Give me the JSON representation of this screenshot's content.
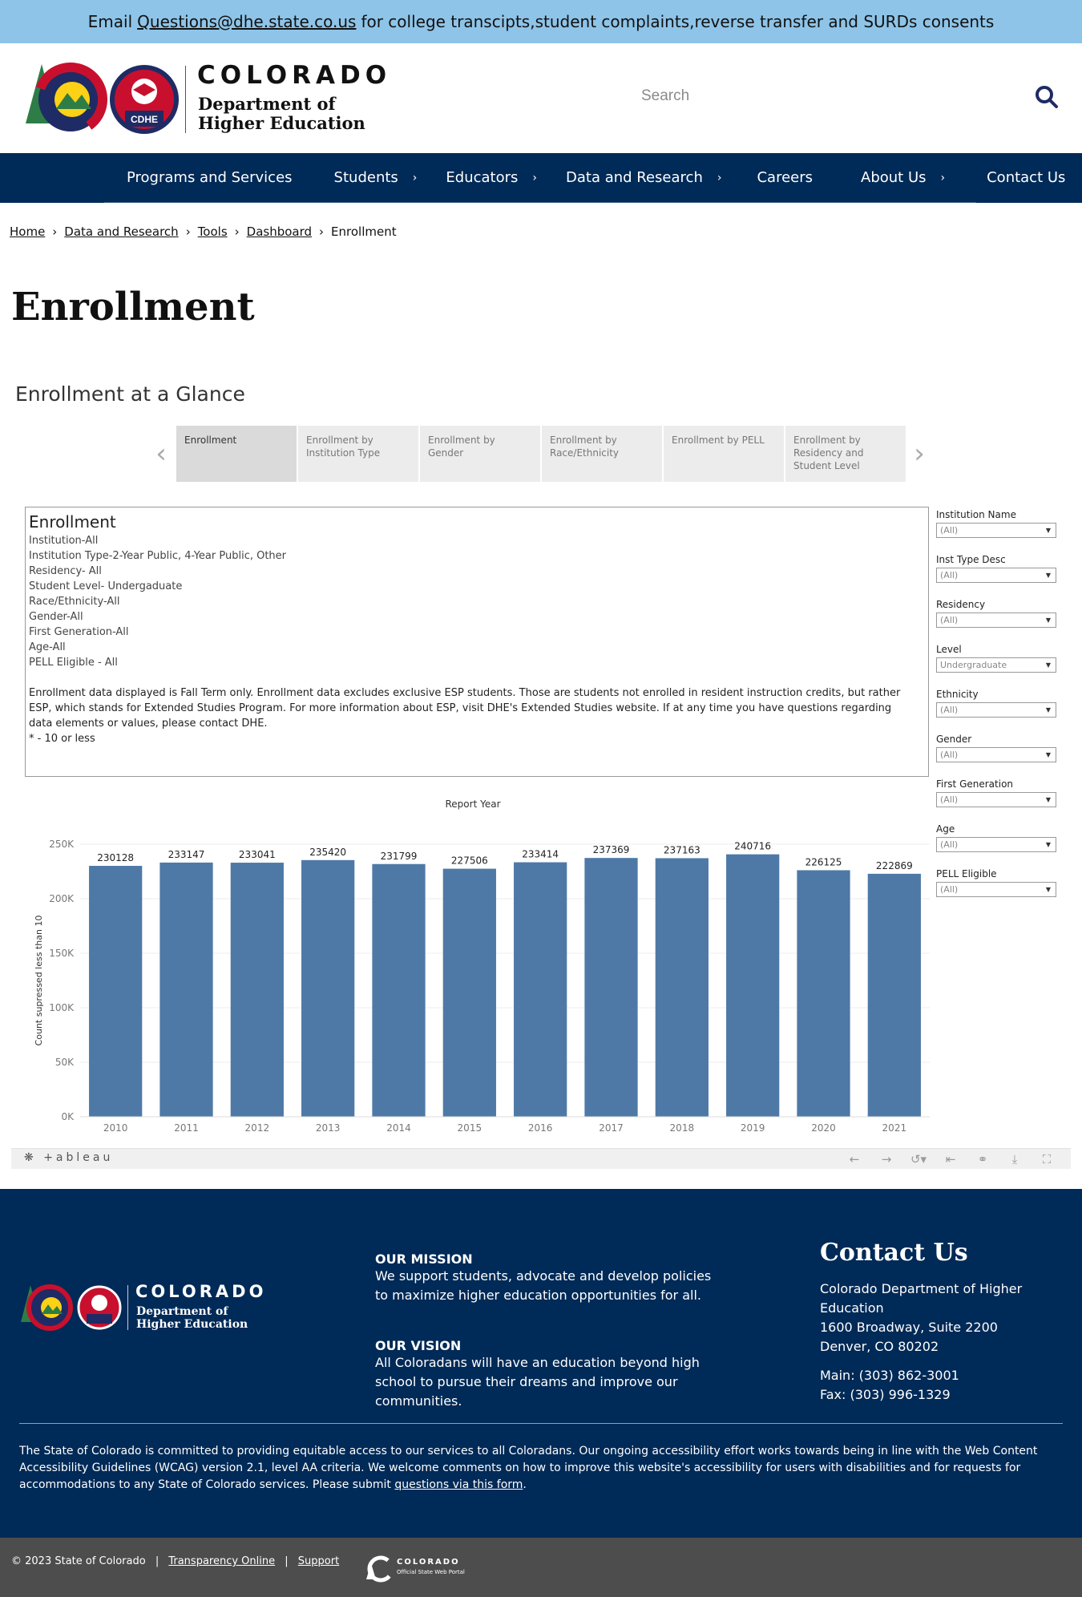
{
  "banner": {
    "prefix": "Email",
    "email": "Questions@dhe.state.co.us",
    "suffix": "for college transcipts,student complaints,reverse transfer and SURDs consents"
  },
  "header": {
    "brand": "COLORADO",
    "dept_line1": "Department of",
    "dept_line2": "Higher Education",
    "logo_badge": "CDHE",
    "search_placeholder": "Search"
  },
  "nav": [
    {
      "label": "Programs and Services",
      "has_chevron": false
    },
    {
      "label": "Students",
      "has_chevron": true
    },
    {
      "label": "Educators",
      "has_chevron": true
    },
    {
      "label": "Data and Research",
      "has_chevron": true
    },
    {
      "label": "Careers",
      "has_chevron": false
    },
    {
      "label": "About Us",
      "has_chevron": true
    },
    {
      "label": "Contact Us",
      "has_chevron": false
    }
  ],
  "breadcrumb": [
    "Home",
    "Data and Research",
    "Tools",
    "Dashboard",
    "Enrollment"
  ],
  "page_title": "Enrollment",
  "section_title": "Enrollment at a Glance",
  "tabs": [
    "Enrollment",
    "Enrollment by Institution Type",
    "Enrollment by Gender",
    "Enrollment by Race/Ethnicity",
    "Enrollment by PELL",
    "Enrollment by Residency and Student Level"
  ],
  "info": {
    "heading": "Enrollment",
    "lines": [
      "Institution-All",
      "Institution Type-2-Year Public, 4-Year Public, Other",
      "Residency- All",
      "Student Level- Undergaduate",
      "Race/Ethnicity-All",
      "Gender-All",
      "First Generation-All",
      "Age-All",
      "PELL Eligible - All"
    ],
    "note": "Enrollment data displayed is Fall Term only. Enrollment data excludes exclusive ESP students. Those are students not enrolled in resident instruction credits, but rather ESP, which stands for Extended Studies Program. For more information about ESP, visit DHE's Extended Studies website. If at any time you have questions regarding data elements or values, please contact DHE.",
    "footnote": "* - 10 or less"
  },
  "filters": [
    {
      "label": "Institution Name",
      "value": "(All)"
    },
    {
      "label": "Inst Type Desc",
      "value": "(All)"
    },
    {
      "label": "Residency",
      "value": "(All)"
    },
    {
      "label": "Level",
      "value": "Undergraduate"
    },
    {
      "label": "Ethnicity",
      "value": "(All)"
    },
    {
      "label": "Gender",
      "value": "(All)"
    },
    {
      "label": "First Generation",
      "value": "(All)"
    },
    {
      "label": "Age",
      "value": "(All)"
    },
    {
      "label": "PELL Eligible",
      "value": "(All)"
    }
  ],
  "chart_data": {
    "type": "bar",
    "title": "Report Year",
    "xlabel": "",
    "ylabel": "Count supressed less than 10",
    "categories": [
      "2010",
      "2011",
      "2012",
      "2013",
      "2014",
      "2015",
      "2016",
      "2017",
      "2018",
      "2019",
      "2020",
      "2021"
    ],
    "values": [
      230128,
      233147,
      233041,
      235420,
      231799,
      227506,
      233414,
      237369,
      237163,
      240716,
      226125,
      222869
    ],
    "ylim": [
      0,
      250000
    ],
    "yticks": [
      0,
      50000,
      100000,
      150000,
      200000,
      250000
    ],
    "ytick_labels": [
      "0K",
      "50K",
      "100K",
      "150K",
      "200K",
      "250K"
    ],
    "bar_color": "#4e79a7",
    "grid": true
  },
  "tableau": {
    "logo": "+ableau"
  },
  "footer": {
    "brand": "COLORADO",
    "dept_line1": "Department of",
    "dept_line2": "Higher Education",
    "mission_title": "OUR MISSION",
    "mission_text": "We support students, advocate and develop policies to maximize higher education opportunities for all.",
    "vision_title": "OUR VISION",
    "vision_text": "All Coloradans will have an education beyond high school to pursue their dreams and improve our communities.",
    "contact_title": "Contact Us",
    "contact_org": "Colorado Department of Higher Education",
    "contact_addr1": "1600 Broadway, Suite 2200",
    "contact_addr2": "Denver, CO 80202",
    "contact_main": "Main: (303) 862-3001",
    "contact_fax": "Fax: (303) 996-1329",
    "access_text": "The State of Colorado is committed to providing equitable access to our services to all Coloradans. Our ongoing accessibility effort works towards being in line with the Web Content Accessibility Guidelines (WCAG) version 2.1, level AA criteria. We welcome comments on how to improve this website's accessibility for users with disabilities and for requests for accommodations to any State of Colorado services. Please submit",
    "access_link": "questions via this form",
    "access_end": "."
  },
  "bottom": {
    "copyright": "© 2023 State of Colorado",
    "transparency": "Transparency Online",
    "support": "Support",
    "portal_brand": "COLORADO",
    "portal_sub": "Official State Web Portal"
  },
  "colors": {
    "banner": "#8ec4e8",
    "navy": "#002a57",
    "bar": "#4e79a7",
    "bottom_bar": "#4d4d4d"
  }
}
